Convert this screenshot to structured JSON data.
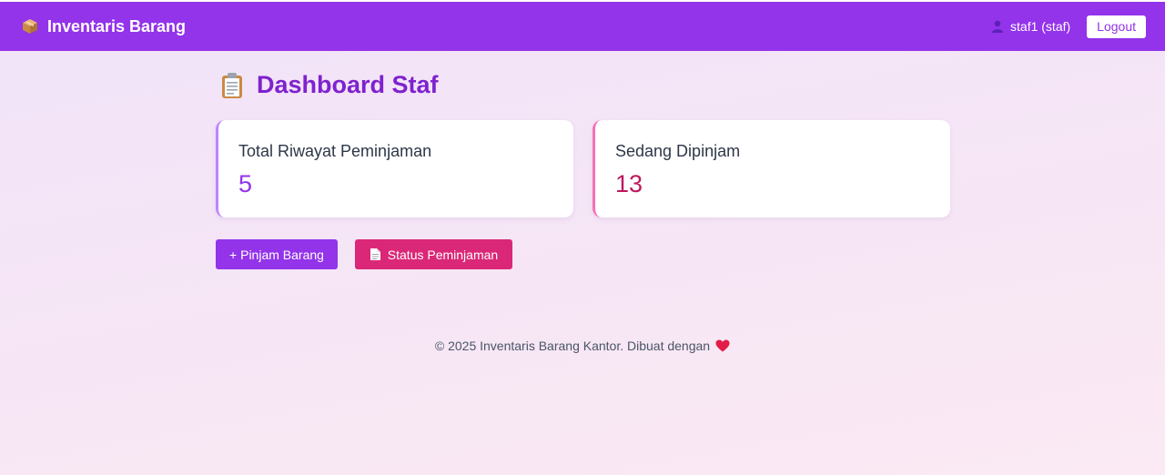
{
  "navbar": {
    "brand": "Inventaris Barang",
    "brand_icon": "package-box-icon",
    "user_label": "staf1 (staf)",
    "user_icon": "user-icon",
    "logout_label": "Logout"
  },
  "page": {
    "title": "Dashboard Staf",
    "title_icon": "clipboard-icon"
  },
  "stats": [
    {
      "label": "Total Riwayat Peminjaman",
      "value": "5",
      "accent": "#c084fc",
      "value_color": "#9333ea"
    },
    {
      "label": "Sedang Dipinjam",
      "value": "13",
      "accent": "#f472b6",
      "value_color": "#be185d"
    }
  ],
  "actions": {
    "pinjam_label": "+ Pinjam Barang",
    "status_label": "Status Peminjaman"
  },
  "footer": {
    "text": "© 2025 Inventaris Barang Kantor. Dibuat dengan",
    "icon": "heart-icon"
  },
  "colors": {
    "primary": "#9333ea",
    "secondary": "#db2777",
    "title": "#7e22ce"
  }
}
